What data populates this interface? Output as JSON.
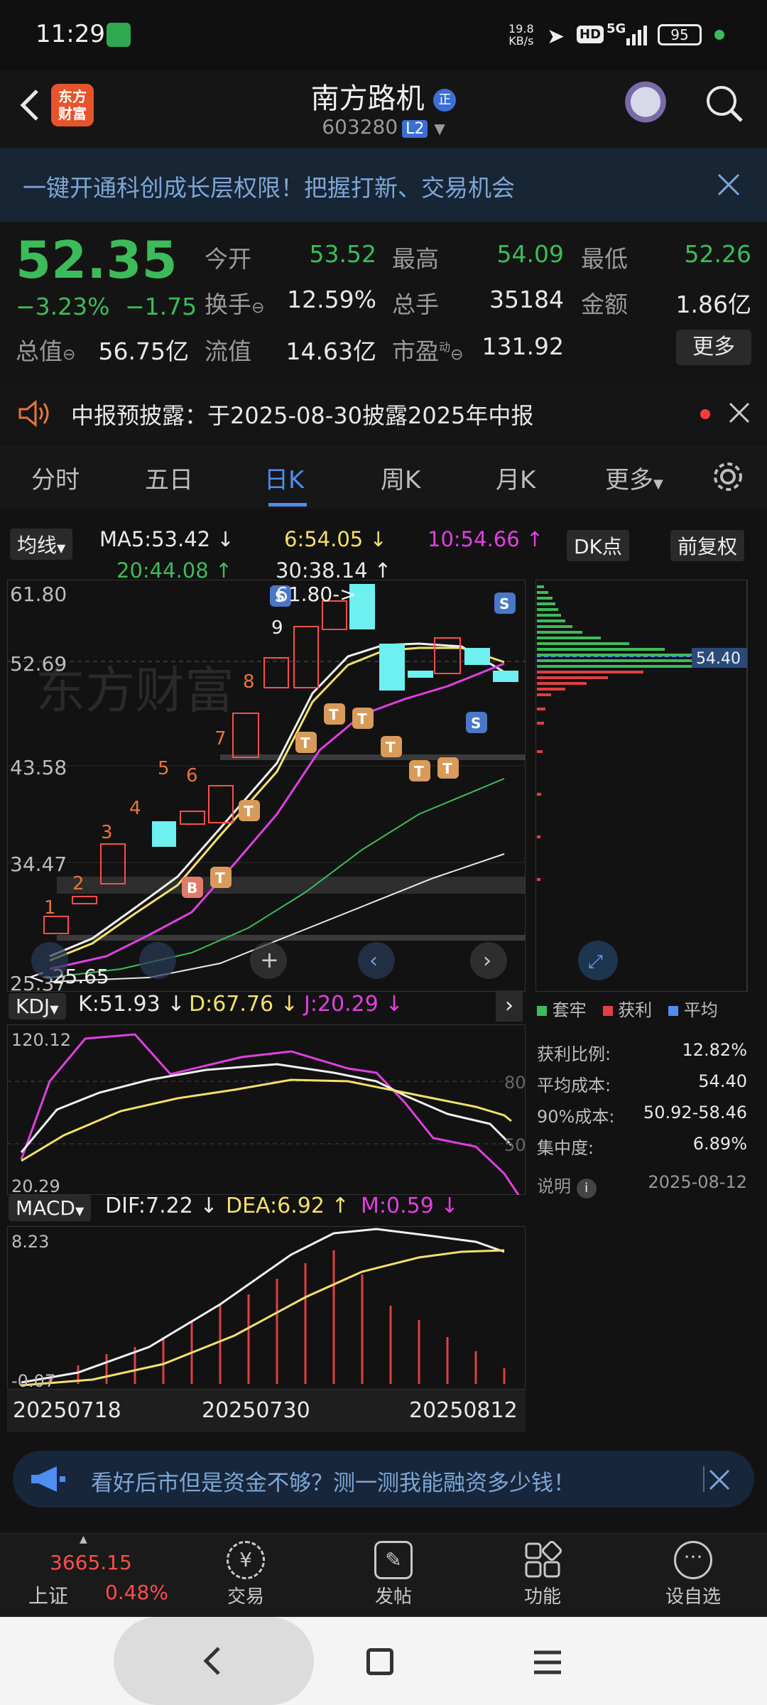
{
  "status_bar": {
    "time": "11:29",
    "net_speed_value": "19.8",
    "net_speed_unit": "KB/s",
    "hd": "HD",
    "network": "5G",
    "battery": "95"
  },
  "header": {
    "logo_text_1": "东方",
    "logo_text_2": "财富",
    "stock_name": "南方路机",
    "name_badge": "正",
    "stock_code": "603280",
    "level_badge": "L2"
  },
  "banner": {
    "text": "一键开通科创成长层权限！把握打新、交易机会"
  },
  "quote": {
    "price": "52.35",
    "change_pct": "−3.23%",
    "change_amt": "−1.75",
    "open_label": "今开",
    "open_value": "53.52",
    "high_label": "最高",
    "high_value": "54.09",
    "low_label": "最低",
    "low_value": "52.26",
    "turnover_label": "换手",
    "turnover_value": "12.59%",
    "volume_label": "总手",
    "volume_value": "35184",
    "amount_label": "金额",
    "amount_value": "1.86亿",
    "mktcap_label": "总值",
    "mktcap_value": "56.75亿",
    "float_label": "流值",
    "float_value": "14.63亿",
    "pe_label": "市盈",
    "pe_super": "动",
    "pe_value": "131.92",
    "more_button": "更多"
  },
  "notice": {
    "text": "中报预披露：于2025-08-30披露2025年中报"
  },
  "tabs": {
    "items": [
      "分时",
      "五日",
      "日K",
      "周K",
      "月K",
      "更多"
    ],
    "active": "日K"
  },
  "indicators": {
    "ma_select": "均线",
    "ma5": "MA5:53.42",
    "ma6": "6:54.05",
    "ma10": "10:54.66",
    "ma20": "20:44.08",
    "ma30": "30:38.14",
    "dk_button": "DK点",
    "adjust_button": "前复权"
  },
  "kline": {
    "y_labels": [
      "61.80",
      "52.69",
      "43.58",
      "34.47",
      "25.37"
    ],
    "high_marker": "61.80->",
    "low_marker": "<-25.65",
    "seq_numbers": [
      "1",
      "2",
      "3",
      "4",
      "5",
      "6",
      "7",
      "8",
      "9"
    ],
    "b_marker": "B",
    "t_marker": "T",
    "s_marker": "S",
    "watermark": "东方财富"
  },
  "chip_dist": {
    "avg_price_tag": "54.40",
    "legend": [
      "套牢",
      "获利",
      "平均"
    ],
    "legend_colors": [
      "#3dbb5a",
      "#e04040",
      "#4d8ef0"
    ],
    "stats": [
      {
        "label": "获利比例:",
        "value": "12.82%"
      },
      {
        "label": "平均成本:",
        "value": "54.40"
      },
      {
        "label": "90%成本:",
        "value": "50.92-58.46"
      },
      {
        "label": "集中度:",
        "value": "6.89%"
      }
    ],
    "note_label": "说明",
    "date": "2025-08-12"
  },
  "kdj": {
    "select": "KDJ",
    "k": "K:51.93",
    "d": "D:67.76",
    "j": "J:20.29",
    "y_top": "120.12",
    "y_bottom": "20.29",
    "ref80": "80",
    "ref50": "50"
  },
  "macd": {
    "select": "MACD",
    "dif": "DIF:7.22",
    "dea": "DEA:6.92",
    "m": "M:0.59",
    "y_top": "8.23",
    "y_bottom": "-0.07"
  },
  "dates": [
    "20250718",
    "20250730",
    "20250812"
  ],
  "adbar": {
    "text": "看好后市但是资金不够？测一测我能融资多少钱！"
  },
  "bottom_nav": {
    "index_value": "3665.15",
    "index_name": "上证",
    "index_change": "0.48%",
    "items": [
      "交易",
      "发帖",
      "功能",
      "设自选"
    ]
  },
  "colors": {
    "up": "#ff4d4d",
    "down": "#3dbb5a",
    "accent": "#4d8ef0",
    "cyan_candle": "#6ef0f0"
  }
}
